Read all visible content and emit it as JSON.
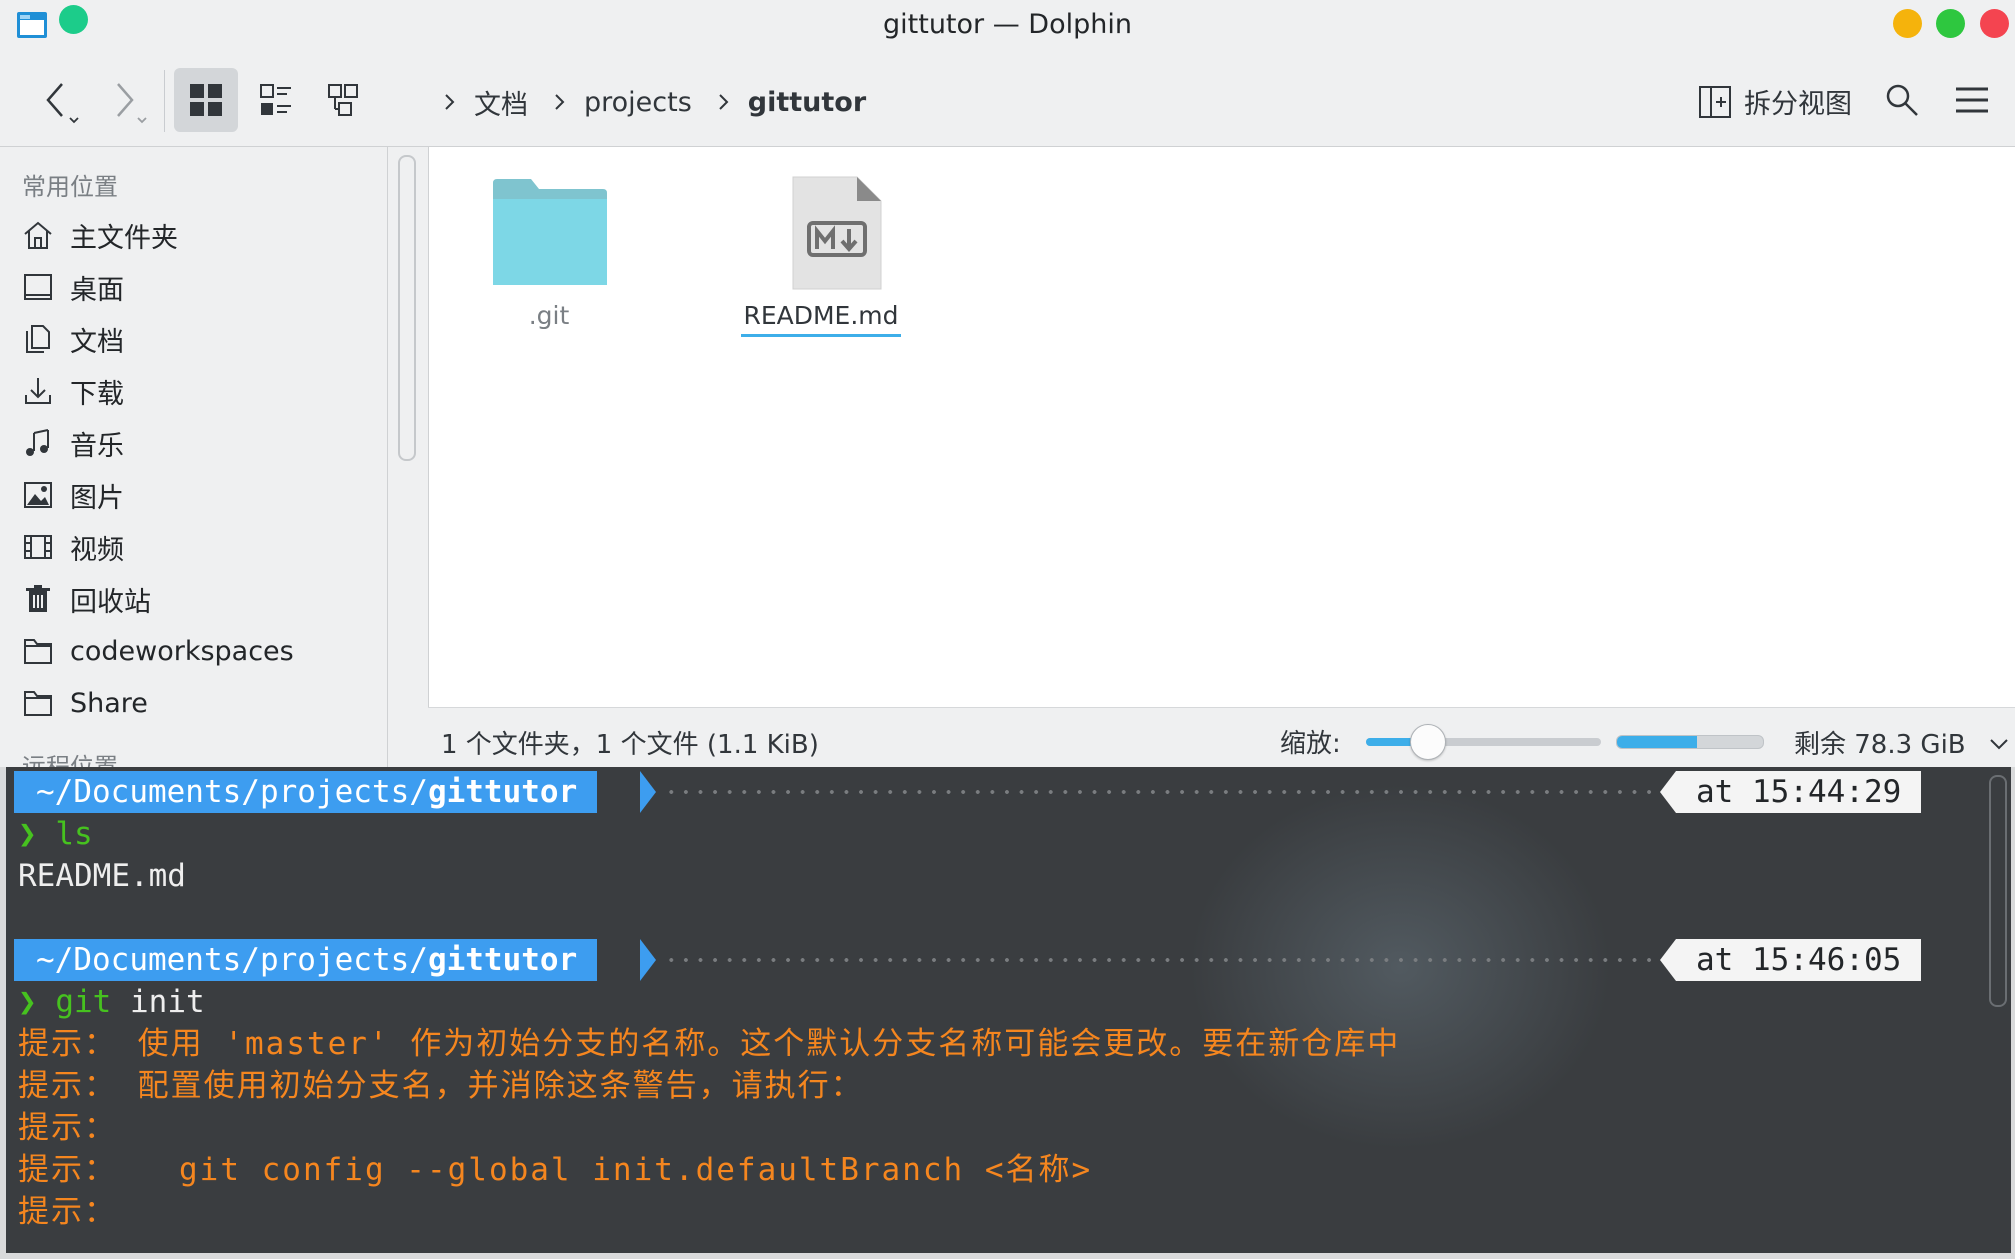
{
  "window": {
    "title": "gittutor — Dolphin",
    "colors": {
      "minimize": "#f5b30c",
      "maximize": "#2ec73f",
      "close": "#f44450",
      "keep_above": "#1ccc8a"
    }
  },
  "toolbar": {
    "breadcrumb": [
      "文档",
      "projects",
      "gittutor"
    ],
    "split_view_label": "拆分视图"
  },
  "sidebar": {
    "places_heading": "常用位置",
    "items": [
      {
        "label": "主文件夹",
        "icon": "home-icon"
      },
      {
        "label": "桌面",
        "icon": "desktop-icon"
      },
      {
        "label": "文档",
        "icon": "documents-icon"
      },
      {
        "label": "下载",
        "icon": "download-icon"
      },
      {
        "label": "音乐",
        "icon": "music-icon"
      },
      {
        "label": "图片",
        "icon": "pictures-icon"
      },
      {
        "label": "视频",
        "icon": "video-icon"
      },
      {
        "label": "回收站",
        "icon": "trash-icon"
      },
      {
        "label": "codeworkspaces",
        "icon": "folder-icon"
      },
      {
        "label": "Share",
        "icon": "folder-icon"
      }
    ],
    "remote_heading": "远程位置"
  },
  "files": [
    {
      "name": ".git",
      "icon": "folder-icon"
    },
    {
      "name": "README.md",
      "icon": "markdown-file-icon"
    }
  ],
  "statusbar": {
    "summary": "1 个文件夹，1 个文件 (1.1 KiB)",
    "zoom_label": "缩放:",
    "zoom_fraction": 0.22,
    "space_used_fraction": 0.55,
    "free_space": "剩余 78.3 GiB"
  },
  "terminal": {
    "path_prefix": "~/Documents/projects/",
    "path_current": "gittutor",
    "prompt_symbol": "❯",
    "blocks": [
      {
        "time": "at 15:44:29",
        "command": "ls",
        "output": [
          "README.md"
        ]
      },
      {
        "time": "at 15:46:05",
        "command_name": "git",
        "command_args": " init"
      }
    ],
    "hints": [
      "提示： 使用 'master' 作为初始分支的名称。这个默认分支名称可能会更改。要在新仓库中",
      "提示： 配置使用初始分支名，并消除这条警告，请执行：",
      "提示：",
      "提示：   git config --global init.defaultBranch <名称>",
      "提示："
    ]
  }
}
